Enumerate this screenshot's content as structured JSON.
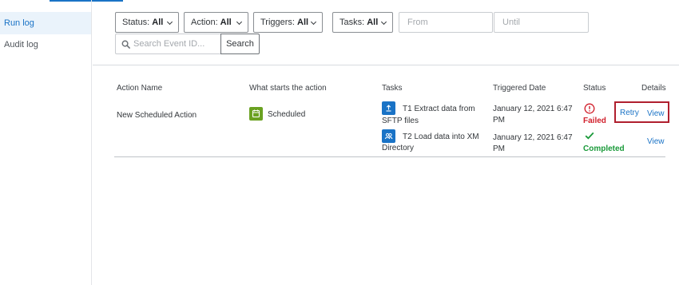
{
  "sidebar": {
    "items": [
      {
        "label": "Run log",
        "active": true
      },
      {
        "label": "Audit log",
        "active": false
      }
    ]
  },
  "filters": {
    "status": {
      "label": "Status:",
      "value": "All"
    },
    "action": {
      "label": "Action:",
      "value": "All"
    },
    "triggers": {
      "label": "Triggers:",
      "value": "All"
    },
    "tasks": {
      "label": "Tasks:",
      "value": "All"
    },
    "from_placeholder": "From",
    "until_placeholder": "Until",
    "search_placeholder": "Search Event ID...",
    "search_button": "Search"
  },
  "table": {
    "headers": [
      "Action Name",
      "What starts the action",
      "Tasks",
      "Triggered Date",
      "Status",
      "Details"
    ],
    "row": {
      "action_name": "New Scheduled Action",
      "trigger": "Scheduled",
      "tasks": [
        {
          "line1": "T1 Extract data from",
          "line2": "SFTP files",
          "date_line1": "January 12, 2021 6:47",
          "date_line2": "PM",
          "status": "Failed",
          "links": [
            "Retry",
            "View"
          ]
        },
        {
          "line1": "T2 Load data into XM",
          "line2": "Directory",
          "date_line1": "January 12, 2021 6:47",
          "date_line2": "PM",
          "status": "Completed",
          "links": [
            "View"
          ]
        }
      ]
    }
  },
  "colors": {
    "accent": "#1a73c6",
    "failed": "#d1202c",
    "completed": "#1a9a3a",
    "trigger_icon": "#6aa121",
    "highlight": "#b01f2e"
  }
}
